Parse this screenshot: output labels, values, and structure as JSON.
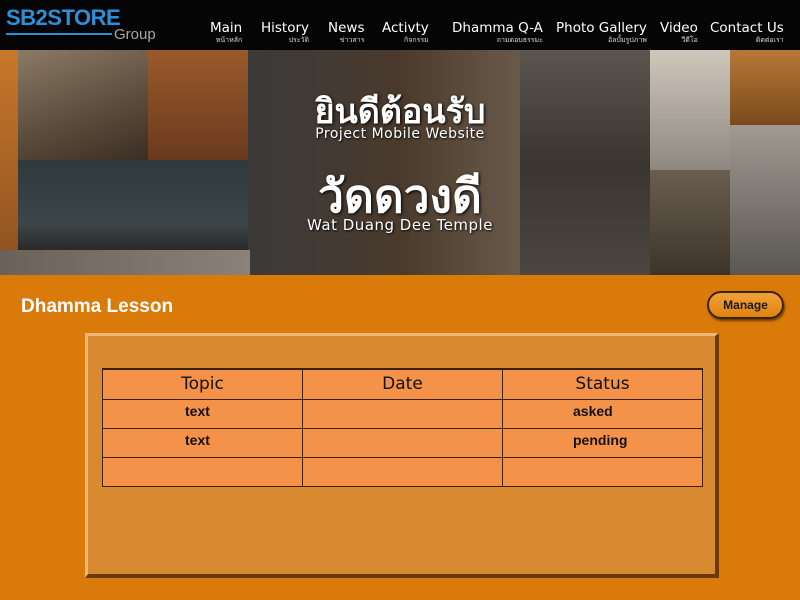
{
  "header": {
    "logo_main": "SB2STORE",
    "logo_sub": "Group",
    "nav": [
      {
        "label": "Main",
        "sub": "หน้าหลัก"
      },
      {
        "label": "History",
        "sub": "ประวัติ"
      },
      {
        "label": "News",
        "sub": "ข่าวสาร"
      },
      {
        "label": "Activty",
        "sub": "กิจกรรม"
      },
      {
        "label": "Dhamma Q-A",
        "sub": "ถามตอบธรรมะ"
      },
      {
        "label": "Photo Gallery",
        "sub": "อัลบั้มรูปภาพ"
      },
      {
        "label": "Video",
        "sub": "วีดีโอ"
      },
      {
        "label": "Contact Us",
        "sub": "ติดต่อเรา"
      }
    ]
  },
  "banner": {
    "welcome_th": "ยินดีต้อนรับ",
    "welcome_en": "Project Mobile Website",
    "temple_th": "วัดดวงดี",
    "temple_en": "Wat Duang Dee Temple"
  },
  "content": {
    "title": "Dhamma Lesson",
    "manage_label": "Manage",
    "table": {
      "headers": [
        "Topic",
        "Date",
        "Status"
      ],
      "rows": [
        {
          "topic": "text",
          "date": "",
          "status": "asked"
        },
        {
          "topic": "text",
          "date": "",
          "status": "pending"
        },
        {
          "topic": "",
          "date": "",
          "status": ""
        }
      ]
    }
  },
  "colors": {
    "page_bg": "#d97a0a",
    "nav_bg": "#050505",
    "logo_blue": "#2e8fd6",
    "panel_bg": "#d98a30",
    "table_cell": "#f5924a"
  }
}
